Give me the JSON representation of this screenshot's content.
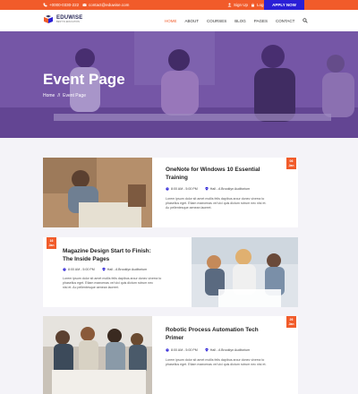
{
  "topbar": {
    "phone": "+0000-0330-222",
    "email": "contact@eduwise.com",
    "signup": "Sign Up",
    "login": "Log In",
    "apply": "APPLY NOW"
  },
  "brand": {
    "name": "EDUWISE",
    "tagline": "BEST IN EDUCATION"
  },
  "nav": [
    "HOME",
    "ABOUT",
    "COURSES",
    "BLOG",
    "PAGES",
    "CONTACT"
  ],
  "hero": {
    "title": "Event Page",
    "breadcrumb": {
      "home": "Home",
      "sep": "//",
      "current": "Event Page"
    }
  },
  "events": [
    {
      "day": "06",
      "month": "Jan",
      "title_line1": "OneNote for Windows 10 Essential",
      "title_line2": "Training",
      "time": "8:00 AM - 5:00 PM",
      "location": "Hall - A Brooklyn Auditorium",
      "desc_line1": "Lorem ipsum dolor sit amet mollis felis dapibus arcur donec viverra to",
      "desc_line2": "phasellus eget. Etiam maecenas vel vici quis dictum rutrum nec nisi et.",
      "desc_line3": "Ac pellentesque aenean laoreet."
    },
    {
      "day": "16",
      "month": "Jan",
      "title_line1": "Magazine Design Start to Finish:",
      "title_line2": "The Inside Pages",
      "time": "8:00 AM - 5:00 PM",
      "location": "Hall - A Brooklyn Auditorium",
      "desc_line1": "Lorem ipsum dolor sit amet mollis felis dapibus arcur donec viverra to",
      "desc_line2": "phasellus eget. Etiam maecenas vel vici quis dictum rutrum nec",
      "desc_line3": "nisi et. Ac pellentesque aenean laoreet."
    },
    {
      "day": "26",
      "month": "Jan",
      "title_line1": "Robotic Process Automation Tech",
      "title_line2": "Primer",
      "time": "8:00 AM - 5:00 PM",
      "location": "Hall - A Brooklyn Auditorium",
      "desc_line1": "Lorem ipsum dolor sit amet mollis felis dapibus arcur donec viverra to",
      "desc_line2": "phasellus eget. Etiam maecenas vel vici quis dictum rutrum nec nisi et."
    }
  ],
  "colors": {
    "accent": "#f15b2a",
    "apply_button": "#2a1fd6",
    "hero_overlay": "#5c3c96",
    "page_bg": "#f4f3f8"
  },
  "icons": [
    "phone-icon",
    "envelope-icon",
    "user-icon",
    "lock-icon",
    "search-icon",
    "clock-icon",
    "map-pin-icon"
  ]
}
